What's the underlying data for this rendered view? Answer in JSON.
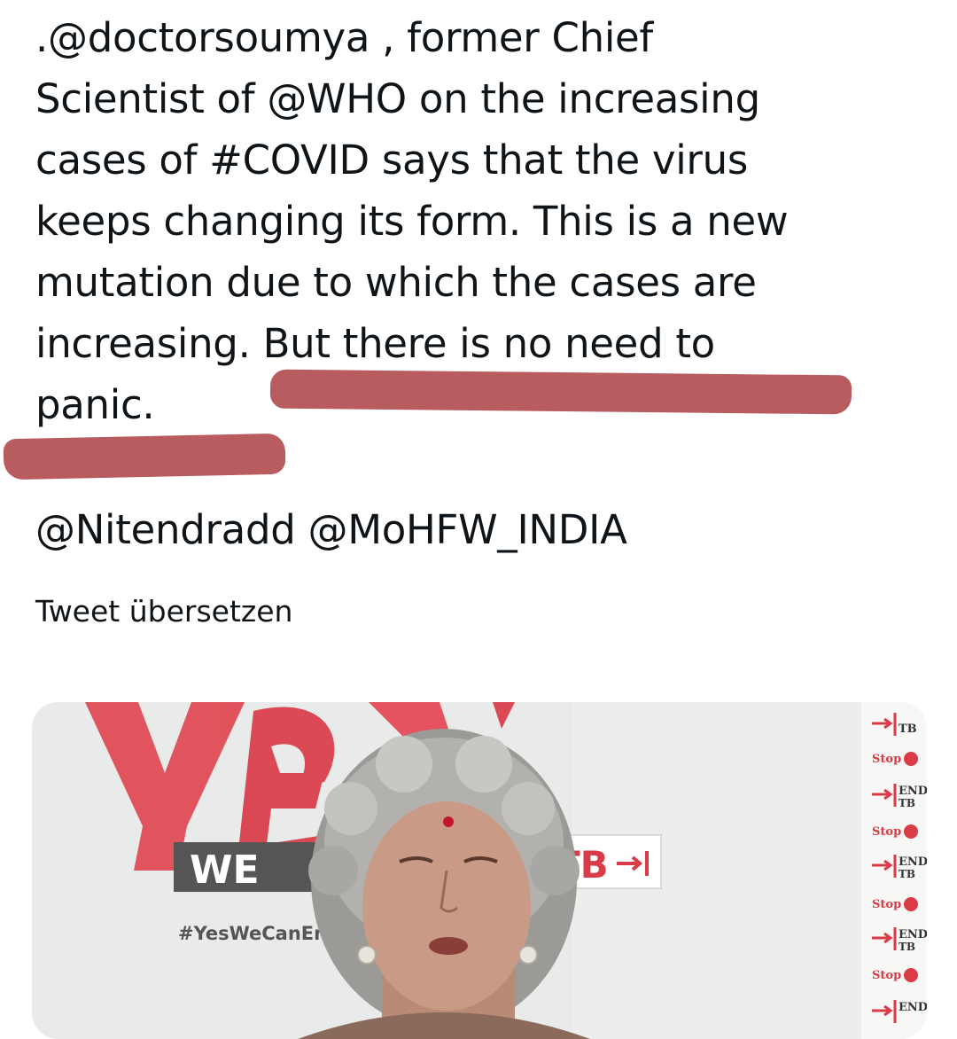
{
  "tweet": {
    "text_lines": [
      ".@doctorsoumya , former Chief",
      "Scientist of @WHO on the increasing",
      "cases of #COVID  says that the virus",
      "keeps changing its form. This is a new",
      "mutation due to which the cases are",
      "increasing. But there is no need to",
      "panic."
    ],
    "mentions": "@Nitendradd @MoHFW_INDIA",
    "translate_label": "Tweet übersetzen"
  },
  "media": {
    "banner_slogan_we": "WE",
    "banner_yes": "YES",
    "banner_tb": "TB",
    "banner_hashtag": "#YesWeCanEn",
    "side_panel_end": "END",
    "side_panel_tb": "TB",
    "side_panel_stop": "Stop",
    "highlight_color": "#b95c5f"
  }
}
